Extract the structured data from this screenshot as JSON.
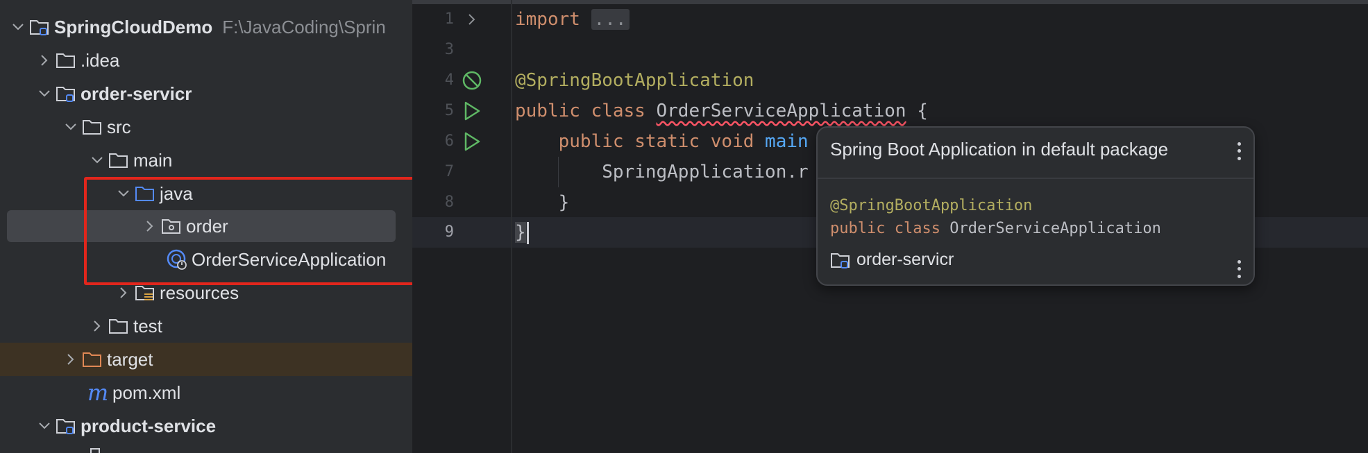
{
  "project_tree": {
    "items": [
      {
        "label": "SpringCloudDemo",
        "path": "F:\\JavaCoding\\Sprin"
      },
      {
        "label": ".idea"
      },
      {
        "label": "order-servicr"
      },
      {
        "label": "src"
      },
      {
        "label": "main"
      },
      {
        "label": "java"
      },
      {
        "label": "order"
      },
      {
        "label": "OrderServiceApplication"
      },
      {
        "label": "resources"
      },
      {
        "label": "test"
      },
      {
        "label": "target"
      },
      {
        "label": "pom.xml"
      },
      {
        "label": "product-service"
      }
    ],
    "selected_item": "order"
  },
  "editor": {
    "line_numbers": [
      "1",
      "3",
      "4",
      "5",
      "6",
      "7",
      "8",
      "9"
    ],
    "code": {
      "l1_kw": "import",
      "l1_fold": "...",
      "l4_ann": "@SpringBootApplication",
      "l5_kw": "public class",
      "l5_cls": "OrderServiceApplication",
      "l5_brace": "{",
      "l6_kw": "public static void",
      "l6_fn": "main",
      "l7_text": "SpringApplication.r",
      "l8_brace": "}",
      "l9_brace": "}"
    }
  },
  "popup": {
    "title": "Spring Boot Application in default package",
    "annotation": "@SpringBootApplication",
    "decl_kw": "public class",
    "decl_name": "OrderServiceApplication",
    "module": "order-servicr"
  },
  "colors": {
    "annotation_box": "#e1261c",
    "keyword": "#cf8e6d",
    "annotation": "#b3ae60",
    "method": "#56a8f5",
    "run_icon": "#5fb865"
  }
}
